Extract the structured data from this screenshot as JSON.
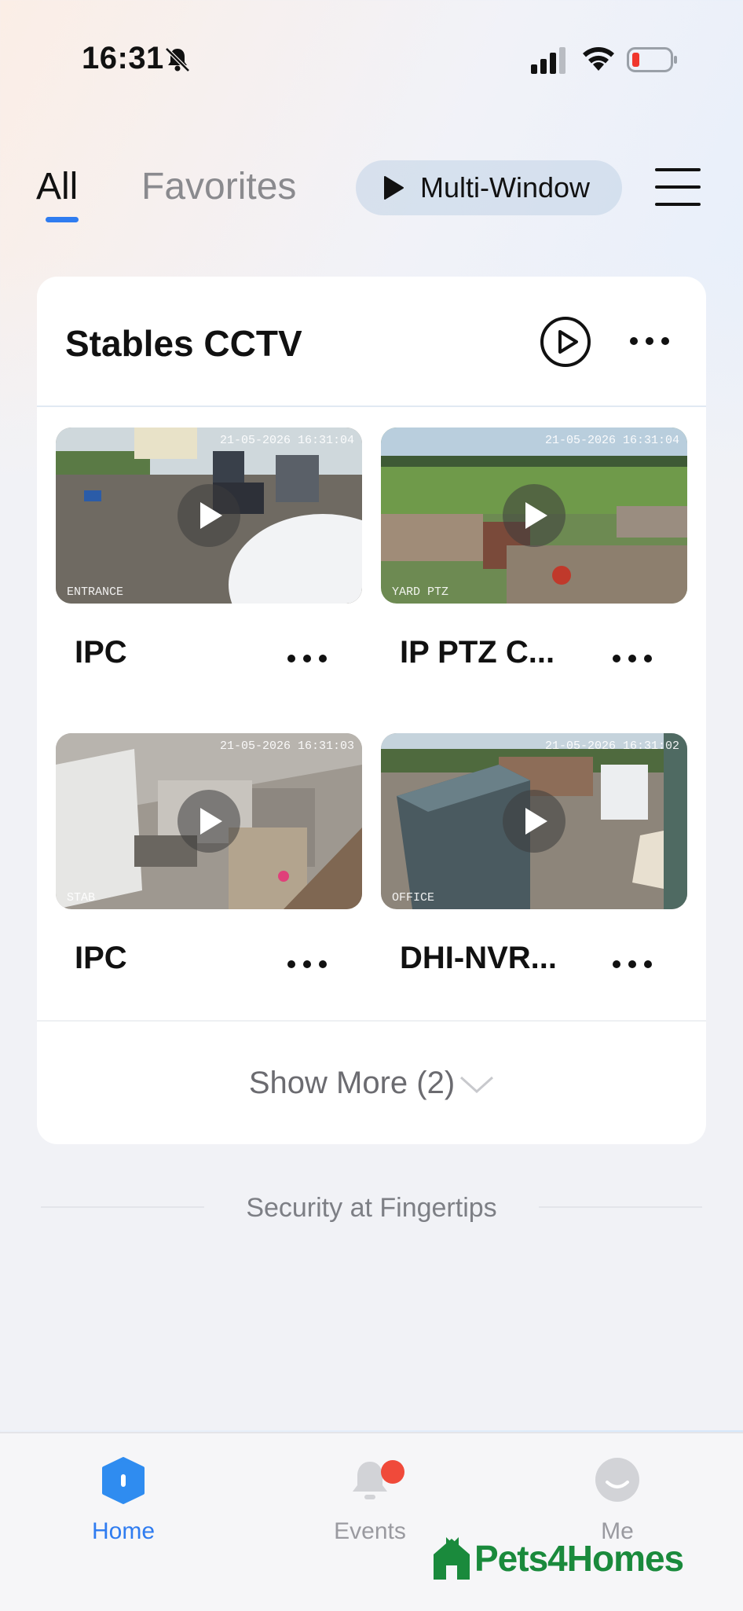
{
  "status_bar": {
    "time": "16:31"
  },
  "header": {
    "tabs": [
      {
        "label": "All",
        "active": true
      },
      {
        "label": "Favorites",
        "active": false
      }
    ],
    "multi_window_label": "Multi-Window"
  },
  "card": {
    "title": "Stables CCTV",
    "cameras": [
      {
        "name": "IPC",
        "timestamp": "21-05-2026 16:31:04",
        "overlay_label": "ENTRANCE"
      },
      {
        "name": "IP PTZ C...",
        "timestamp": "21-05-2026 16:31:04",
        "overlay_label": "YARD PTZ"
      },
      {
        "name": "IPC",
        "timestamp": "21-05-2026 16:31:03",
        "overlay_label": "STAB"
      },
      {
        "name": "DHI-NVR...",
        "timestamp": "21-05-2026 16:31:02",
        "overlay_label": "OFFICE"
      }
    ],
    "show_more_label": "Show More (2)"
  },
  "tagline": "Security at Fingertips",
  "bottom_nav": [
    {
      "label": "Home",
      "icon": "home-icon",
      "active": true
    },
    {
      "label": "Events",
      "icon": "bell-icon",
      "active": false
    },
    {
      "label": "Me",
      "icon": "profile-icon",
      "active": false
    }
  ],
  "watermark": "Pets4Homes",
  "colors": {
    "accent": "#2f7cf0",
    "badge": "#f04a3a",
    "watermark": "#1a8a3c"
  }
}
